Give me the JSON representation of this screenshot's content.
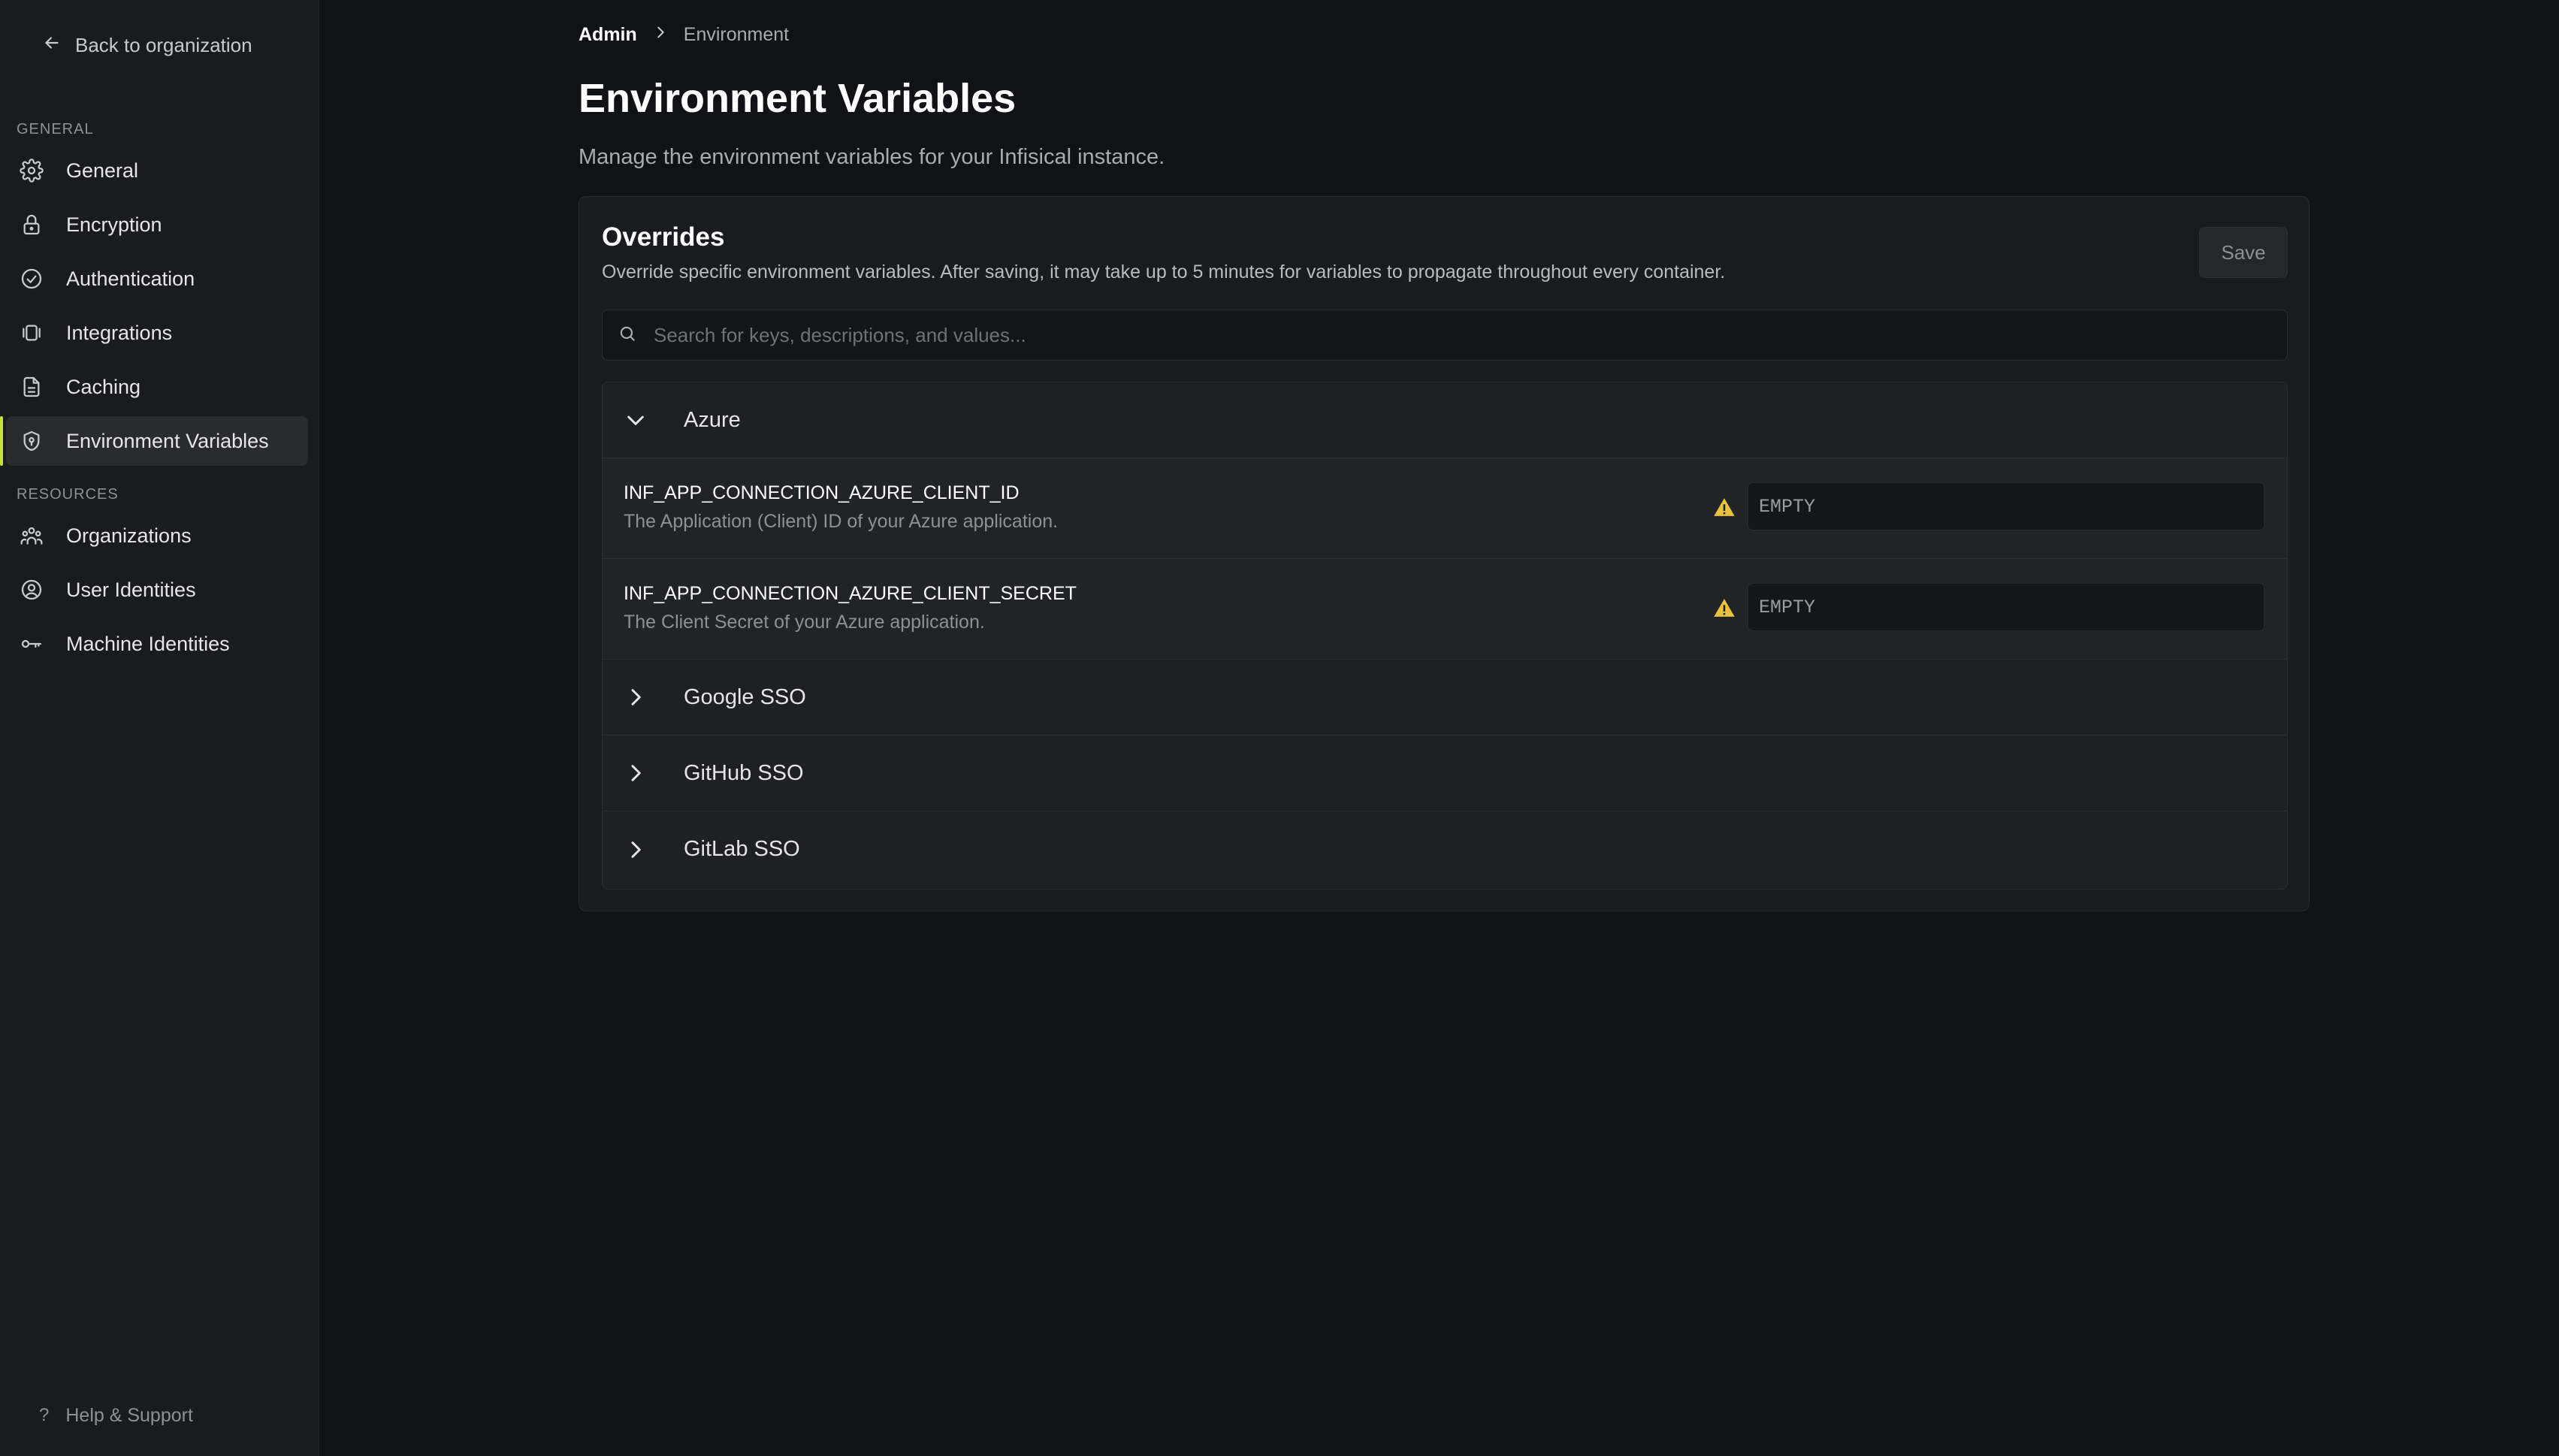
{
  "sidebar": {
    "back_label": "Back to organization",
    "general_label": "GENERAL",
    "resources_label": "RESOURCES",
    "general_items": [
      {
        "label": "General",
        "icon": "gear-icon"
      },
      {
        "label": "Encryption",
        "icon": "lock-icon"
      },
      {
        "label": "Authentication",
        "icon": "check-circle-icon"
      },
      {
        "label": "Integrations",
        "icon": "integrations-icon"
      },
      {
        "label": "Caching",
        "icon": "document-icon"
      },
      {
        "label": "Environment Variables",
        "icon": "shield-lock-icon",
        "active": true
      }
    ],
    "resource_items": [
      {
        "label": "Organizations",
        "icon": "users-group-icon"
      },
      {
        "label": "User Identities",
        "icon": "user-circle-icon"
      },
      {
        "label": "Machine Identities",
        "icon": "key-icon"
      }
    ],
    "help_label": "Help & Support",
    "accent_color": "#c6e236"
  },
  "breadcrumb": {
    "root": "Admin",
    "current": "Environment"
  },
  "page": {
    "title": "Environment Variables",
    "subtitle": "Manage the environment variables for your Infisical instance."
  },
  "overrides": {
    "title": "Overrides",
    "description": "Override specific environment variables. After saving, it may take up to 5 minutes for variables to propagate throughout every container.",
    "save_label": "Save",
    "search_placeholder": "Search for keys, descriptions, and values...",
    "groups": [
      {
        "name": "Azure",
        "expanded": true,
        "variables": [
          {
            "key": "INF_APP_CONNECTION_AZURE_CLIENT_ID",
            "description": "The Application (Client) ID of your Azure application.",
            "value": "",
            "placeholder": "EMPTY"
          },
          {
            "key": "INF_APP_CONNECTION_AZURE_CLIENT_SECRET",
            "description": "The Client Secret of your Azure application.",
            "value": "",
            "placeholder": "EMPTY"
          }
        ]
      },
      {
        "name": "Google SSO",
        "expanded": false
      },
      {
        "name": "GitHub SSO",
        "expanded": false
      },
      {
        "name": "GitLab SSO",
        "expanded": false
      }
    ],
    "warning_color": "#e9c33b"
  }
}
